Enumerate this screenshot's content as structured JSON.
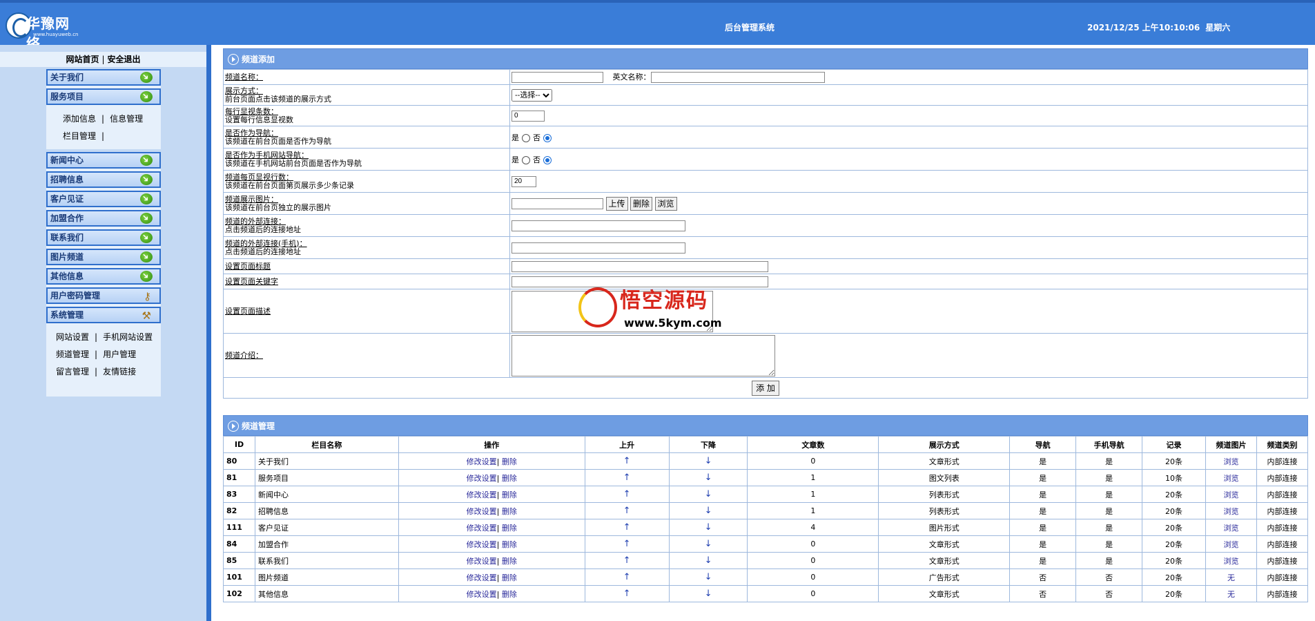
{
  "header": {
    "logo_name": "华豫网络",
    "logo_url": "www.huayuweb.cn",
    "title": "后台管理系统",
    "date": "2021/12/25",
    "time": "上午10:10:06",
    "weekday": "星期六"
  },
  "sidebar": {
    "top_links": [
      "网站首页",
      "安全退出"
    ],
    "group1": [
      {
        "label": "关于我们",
        "icon": "green-arrow-icon"
      },
      {
        "label": "服务项目",
        "icon": "green-arrow-icon"
      }
    ],
    "group1_sub": [
      [
        "添加信息",
        "信息管理"
      ],
      [
        "栏目管理",
        ""
      ]
    ],
    "group2": [
      {
        "label": "新闻中心",
        "icon": "green-arrow-icon"
      },
      {
        "label": "招聘信息",
        "icon": "green-arrow-icon"
      },
      {
        "label": "客户见证",
        "icon": "green-arrow-icon"
      },
      {
        "label": "加盟合作",
        "icon": "green-arrow-icon"
      },
      {
        "label": "联系我们",
        "icon": "green-arrow-icon"
      },
      {
        "label": "图片频道",
        "icon": "green-arrow-icon"
      },
      {
        "label": "其他信息",
        "icon": "green-arrow-icon"
      },
      {
        "label": "用户密码管理",
        "icon": "key-icon"
      },
      {
        "label": "系统管理",
        "icon": "tools-icon"
      }
    ],
    "group2_sub": [
      [
        "网站设置",
        "手机网站设置"
      ],
      [
        "频道管理",
        "用户管理"
      ],
      [
        "留言管理",
        "友情链接"
      ]
    ]
  },
  "add_panel": {
    "title": "频道添加",
    "rows": {
      "name": {
        "label": "频道名称：",
        "en_label": "英文名称："
      },
      "display": {
        "label": "展示方式：",
        "desc": "前台页面点击该频道的展示方式",
        "select": "--选择--"
      },
      "per_row": {
        "label": "每行显视条数：",
        "desc": "设置每行信息显视数",
        "value": "0"
      },
      "nav": {
        "label": "是否作为导航：",
        "desc": "该频道在前台页面是否作为导航",
        "yes": "是",
        "no": "否"
      },
      "mobile_nav": {
        "label": "是否作为手机网站导航：",
        "desc": "该频道在手机网站前台页面是否作为导航",
        "yes": "是",
        "no": "否"
      },
      "per_page": {
        "label": "频道每页显视行数：",
        "desc": "该频道在前台页面第页展示多少条记录",
        "value": "20"
      },
      "image": {
        "label": "频道展示图片：",
        "desc": "该频道在前台页独立的展示图片",
        "upload": "上传",
        "delete": "删除",
        "browse": "浏览"
      },
      "ext_link": {
        "label": "频道的外部连接：",
        "desc": "点击频道后的连接地址"
      },
      "ext_link_mobile": {
        "label": "频道的外部连接(手机)：",
        "desc": "点击频道后的连接地址"
      },
      "page_title": {
        "label": "设置页面标题"
      },
      "page_keywords": {
        "label": "设置页面关键字"
      },
      "page_desc": {
        "label": "设置页面描述"
      },
      "intro": {
        "label": "频道介绍："
      }
    },
    "submit": "添 加"
  },
  "manage_panel": {
    "title": "频道管理",
    "columns": [
      "ID",
      "栏目名称",
      "操作",
      "上升",
      "下降",
      "文章数",
      "展示方式",
      "导航",
      "手机导航",
      "记录",
      "频道图片",
      "频道类别"
    ],
    "edit_label": "修改设置",
    "delete_label": "删除",
    "up_symbol": "↑",
    "down_symbol": "↓",
    "rows": [
      {
        "id": "80",
        "name": "关于我们",
        "count": "0",
        "mode": "文章形式",
        "nav": "是",
        "mnav": "是",
        "rec": "20条",
        "img": "浏览",
        "type": "内部连接"
      },
      {
        "id": "81",
        "name": "服务项目",
        "count": "1",
        "mode": "图文列表",
        "nav": "是",
        "mnav": "是",
        "rec": "10条",
        "img": "浏览",
        "type": "内部连接"
      },
      {
        "id": "83",
        "name": "新闻中心",
        "count": "1",
        "mode": "列表形式",
        "nav": "是",
        "mnav": "是",
        "rec": "20条",
        "img": "浏览",
        "type": "内部连接"
      },
      {
        "id": "82",
        "name": "招聘信息",
        "count": "1",
        "mode": "列表形式",
        "nav": "是",
        "mnav": "是",
        "rec": "20条",
        "img": "浏览",
        "type": "内部连接"
      },
      {
        "id": "111",
        "name": "客户见证",
        "count": "4",
        "mode": "图片形式",
        "nav": "是",
        "mnav": "是",
        "rec": "20条",
        "img": "浏览",
        "type": "内部连接"
      },
      {
        "id": "84",
        "name": "加盟合作",
        "count": "0",
        "mode": "文章形式",
        "nav": "是",
        "mnav": "是",
        "rec": "20条",
        "img": "浏览",
        "type": "内部连接"
      },
      {
        "id": "85",
        "name": "联系我们",
        "count": "0",
        "mode": "文章形式",
        "nav": "是",
        "mnav": "是",
        "rec": "20条",
        "img": "浏览",
        "type": "内部连接"
      },
      {
        "id": "101",
        "name": "图片频道",
        "count": "0",
        "mode": "广告形式",
        "nav": "否",
        "mnav": "否",
        "rec": "20条",
        "img": "无",
        "type": "内部连接"
      },
      {
        "id": "102",
        "name": "其他信息",
        "count": "0",
        "mode": "文章形式",
        "nav": "否",
        "mnav": "否",
        "rec": "20条",
        "img": "无",
        "type": "内部连接"
      }
    ]
  },
  "watermark": {
    "title": "悟空源码",
    "url": "www.5kym.com"
  },
  "colors": {
    "header": "#3A7DD8",
    "sidebar": "#C4D9F3",
    "panel_head": "#6E9DE2",
    "link": "#28289a"
  }
}
